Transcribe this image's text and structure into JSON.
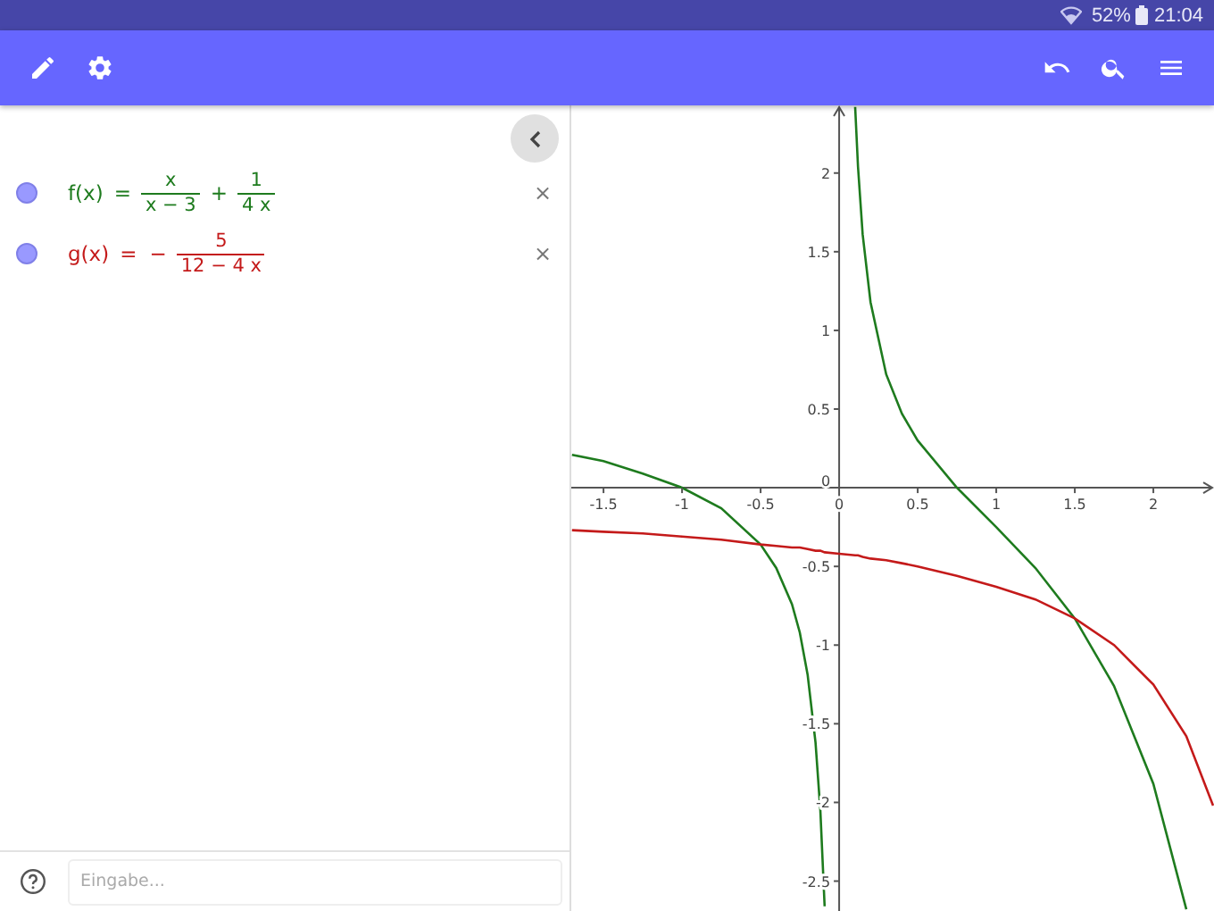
{
  "status_bar": {
    "battery": "52%",
    "time": "21:04"
  },
  "algebra": {
    "items": [
      {
        "visible": true,
        "color": "#1e7b1e",
        "lhs": "f(x)",
        "equals": "=",
        "terms": [
          {
            "num": "x",
            "den": "x − 3"
          },
          {
            "sign": "+",
            "num": "1",
            "den": "4 x"
          }
        ],
        "close": "×"
      },
      {
        "visible": true,
        "color": "#c41a1a",
        "lhs": "g(x)",
        "equals": "=",
        "terms": [
          {
            "sign": "−",
            "num": "5",
            "den": "12 − 4 x"
          }
        ],
        "close": "×"
      }
    ]
  },
  "input_bar": {
    "placeholder": "Eingabe..."
  },
  "graph": {
    "chart_data": {
      "type": "line",
      "xlim": [
        -1.705,
        2.386
      ],
      "ylim": [
        -2.69,
        2.43
      ],
      "xticks": [
        -1.5,
        -1,
        -0.5,
        0,
        0.5,
        1,
        1.5,
        2
      ],
      "yticks": [
        -2.5,
        -2,
        -1.5,
        -1,
        -0.5,
        0,
        0.5,
        1,
        1.5,
        2
      ],
      "x": [
        -1.7,
        -1.5,
        -1.25,
        -1,
        -0.75,
        -0.5,
        -0.4,
        -0.3,
        -0.25,
        -0.2,
        -0.15,
        -0.12,
        -0.093,
        0,
        0.102,
        0.12,
        0.15,
        0.2,
        0.3,
        0.4,
        0.5,
        0.75,
        1,
        1.25,
        1.5,
        1.75,
        2,
        2.21,
        2.38
      ],
      "series": [
        {
          "color": "#1e7b1e",
          "values": [
            0.21,
            0.17,
            0.09,
            0,
            -0.13,
            -0.36,
            -0.51,
            -0.74,
            -0.92,
            -1.19,
            -1.62,
            -2.05,
            -2.66,
            null,
            2.42,
            2.04,
            1.61,
            1.18,
            0.72,
            0.47,
            0.3,
            0,
            -0.25,
            -0.51,
            -0.83,
            -1.26,
            -1.88,
            -2.68,
            null
          ]
        },
        {
          "color": "#c41a1a",
          "values": [
            -0.27,
            -0.28,
            -0.29,
            -0.31,
            -0.33,
            -0.36,
            -0.37,
            -0.38,
            -0.38,
            -0.39,
            -0.4,
            -0.4,
            -0.41,
            -0.42,
            -0.43,
            -0.43,
            -0.44,
            -0.45,
            -0.46,
            -0.48,
            -0.5,
            -0.56,
            -0.63,
            -0.71,
            -0.83,
            -1,
            -1.25,
            -1.58,
            -2.02
          ]
        }
      ]
    }
  }
}
